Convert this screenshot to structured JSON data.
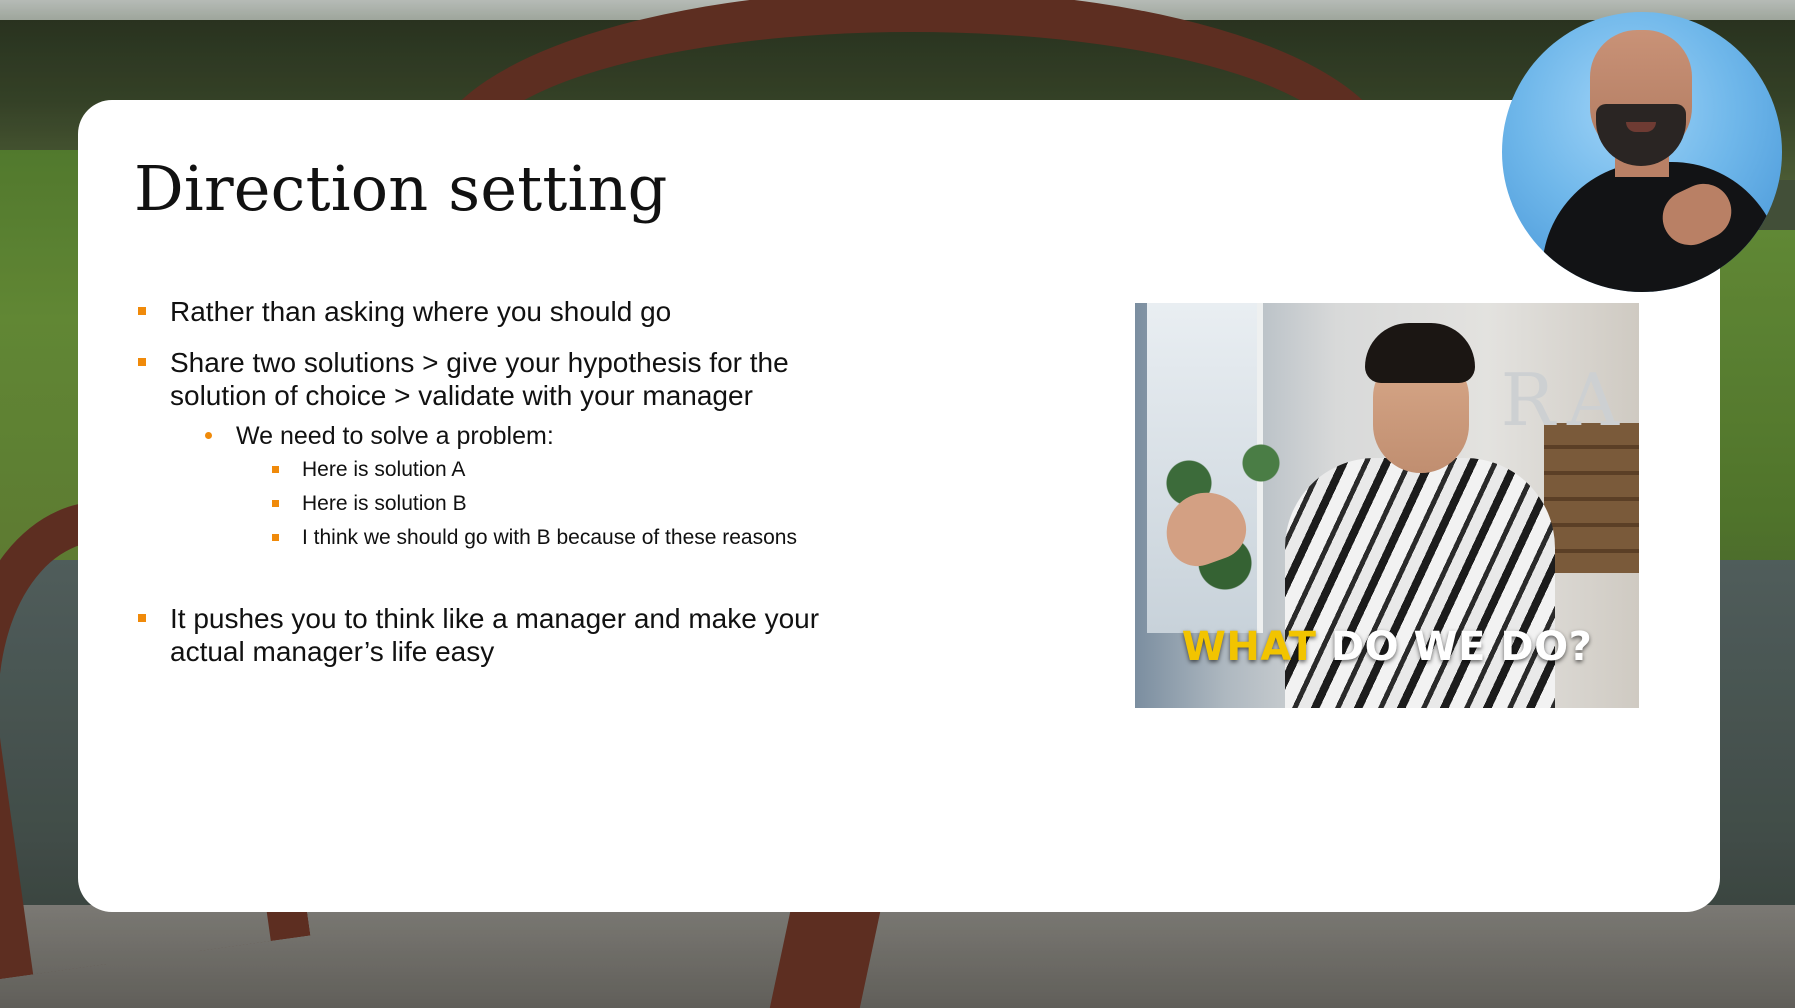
{
  "slide": {
    "title": "Direction setting",
    "bullets": [
      {
        "level": 1,
        "text": "Rather than asking where you should go"
      },
      {
        "level": 1,
        "text": "Share two solutions > give your hypothesis for the solution of choice > validate with your manager"
      },
      {
        "level": 2,
        "text": "We need to solve a problem:"
      },
      {
        "level": 3,
        "text": "Here is solution A"
      },
      {
        "level": 3,
        "text": "Here is solution B"
      },
      {
        "level": 3,
        "text": "I think we should go with B because of these reasons"
      },
      {
        "level": 1,
        "text": "It pushes you to think like a manager and make your actual manager’s life easy"
      }
    ],
    "bullet_color": "#f08a0a"
  },
  "meme": {
    "caption_highlight": "WHAT",
    "caption_rest": "DO WE DO?",
    "highlight_color": "#f2c400",
    "wall_letters": "RA"
  }
}
